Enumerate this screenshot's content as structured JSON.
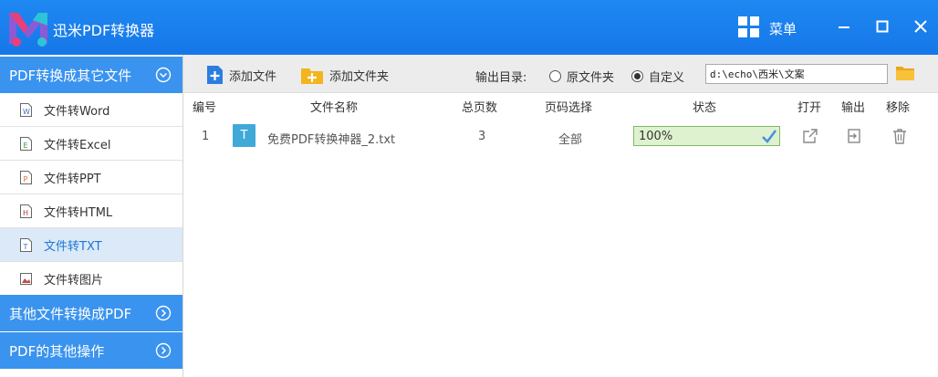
{
  "app": {
    "title": "迅米PDF转换器",
    "menu_label": "菜单"
  },
  "sidebar": {
    "group1": {
      "label": "PDF转换成其它文件"
    },
    "items": [
      {
        "label": "文件转Word",
        "icon_letter": "W",
        "icon_color": "#3a6fc4"
      },
      {
        "label": "文件转Excel",
        "icon_letter": "E",
        "icon_color": "#2e9a3e"
      },
      {
        "label": "文件转PPT",
        "icon_letter": "P",
        "icon_color": "#d0702a"
      },
      {
        "label": "文件转HTML",
        "icon_letter": "H",
        "icon_color": "#b03a3a"
      },
      {
        "label": "文件转TXT",
        "icon_letter": "T",
        "icon_color": "#3a6fc4"
      },
      {
        "label": "文件转图片",
        "icon_letter": "",
        "icon_color": "#c0504d"
      }
    ],
    "active_index": 4,
    "group2": {
      "label": "其他文件转换成PDF"
    },
    "group3": {
      "label": "PDF的其他操作"
    }
  },
  "toolbar": {
    "add_file": "添加文件",
    "add_folder": "添加文件夹",
    "output_label": "输出目录:",
    "radio_original": "原文件夹",
    "radio_custom": "自定义",
    "selected_radio": "custom",
    "output_path": "d:\\echo\\西米\\文案"
  },
  "table": {
    "headers": {
      "index": "编号",
      "name": "文件名称",
      "pages": "总页数",
      "range": "页码选择",
      "status": "状态",
      "open": "打开",
      "export": "输出",
      "remove": "移除"
    },
    "rows": [
      {
        "index": "1",
        "type": "T",
        "name": "免费PDF转换神器_2.txt",
        "pages": "3",
        "range": "全部",
        "progress_text": "100%",
        "progress": 1.0
      }
    ]
  },
  "colors": {
    "titlebar": "#1a80ee",
    "sidebar_header": "#3a93ee",
    "active_item_bg": "#dbe9f8",
    "accent": "#1c77d6",
    "badge": "#3fa9d8"
  }
}
